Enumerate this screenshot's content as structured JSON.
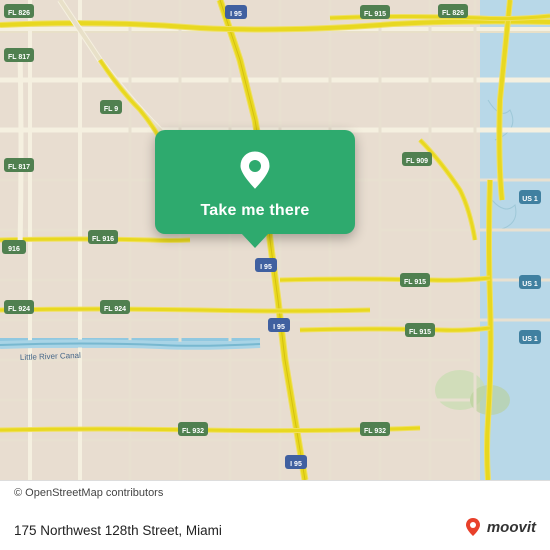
{
  "map": {
    "alt": "OpenStreetMap of Miami area around 175 Northwest 128th Street",
    "copyright": "© OpenStreetMap contributors"
  },
  "card": {
    "button_label": "Take me there",
    "pin_icon": "location-pin"
  },
  "bottom_bar": {
    "address": "175 Northwest 128th Street, Miami",
    "moovit_label": "moovit",
    "copyright": "© OpenStreetMap contributors"
  },
  "road_labels": [
    "FL 826",
    "I 95",
    "FL 915",
    "FL 826",
    "FL 817",
    "FL 9",
    "FL 909",
    "FL 916",
    "US 1",
    "FL 924",
    "I 95",
    "FL 915",
    "US 1",
    "FL 924",
    "I 95",
    "FL 915",
    "US 1",
    "FL 932",
    "FL 932",
    "I 95",
    "Little River Canal",
    "916"
  ]
}
